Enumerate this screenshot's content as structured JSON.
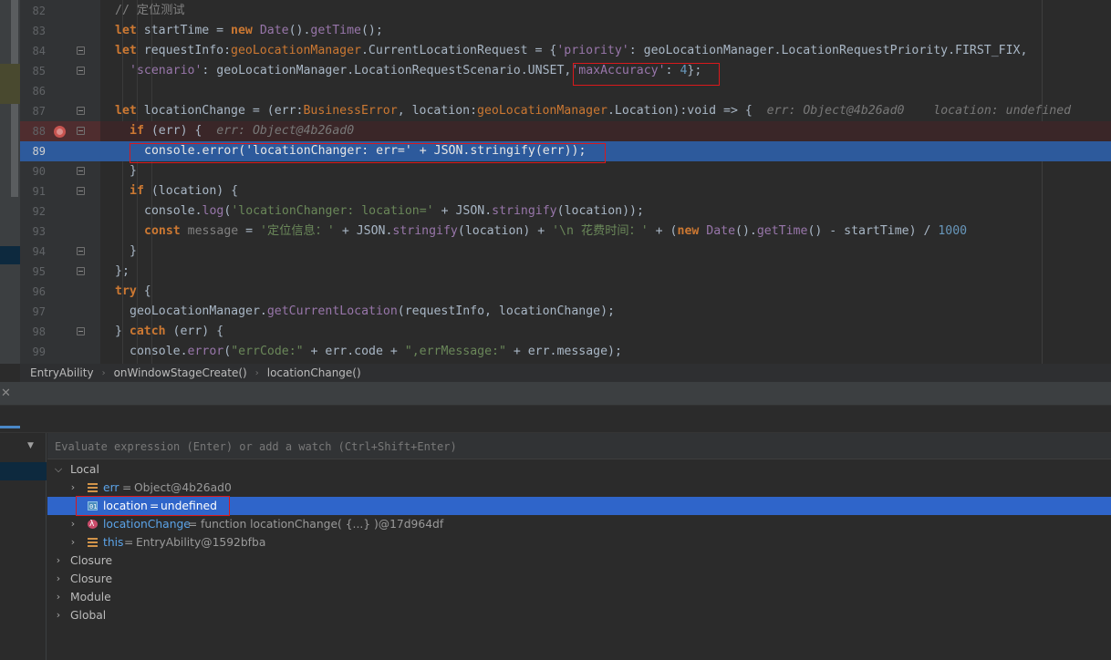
{
  "editor": {
    "lines": [
      {
        "n": "82",
        "parts": [
          {
            "t": "// 定位测试",
            "c": "cmt"
          }
        ]
      },
      {
        "n": "83",
        "parts": [
          {
            "t": "let ",
            "c": "kw"
          },
          {
            "t": "startTime = "
          },
          {
            "t": "new ",
            "c": "kw"
          },
          {
            "t": "Date",
            "c": "prop"
          },
          {
            "t": "()."
          },
          {
            "t": "getTime",
            "c": "prop"
          },
          {
            "t": "();"
          }
        ]
      },
      {
        "n": "84",
        "parts": [
          {
            "t": "let ",
            "c": "kw"
          },
          {
            "t": "requestInfo:"
          },
          {
            "t": "geoLocationManager",
            "c": "kw2"
          },
          {
            "t": ".CurrentLocationRequest = {"
          },
          {
            "t": "'priority'",
            "c": "prop"
          },
          {
            "t": ": geoLocationManager.LocationRequestPriority.FIRST_FIX,"
          }
        ]
      },
      {
        "n": "85",
        "parts": [
          {
            "t": "'scenario'",
            "c": "prop"
          },
          {
            "t": ": geoLocationManager.LocationRequestScenario.UNSET,"
          },
          {
            "t": "'maxAccuracy'",
            "c": "prop"
          },
          {
            "t": ": "
          },
          {
            "t": "4",
            "c": "num"
          },
          {
            "t": "};"
          }
        ]
      },
      {
        "n": "86",
        "parts": []
      },
      {
        "n": "87",
        "parts": [
          {
            "t": "let ",
            "c": "kw"
          },
          {
            "t": "locationChange = ("
          },
          {
            "t": "err",
            "c": ""
          },
          {
            "t": ":"
          },
          {
            "t": "BusinessError",
            "c": "kw2"
          },
          {
            "t": ", location:"
          },
          {
            "t": "geoLocationManager",
            "c": "kw2"
          },
          {
            "t": ".Location):"
          },
          {
            "t": "void",
            "c": ""
          },
          {
            "t": " => {  "
          },
          {
            "t": "err: Object@4b26ad0    location: undefined",
            "c": "hint"
          }
        ]
      },
      {
        "n": "88",
        "parts": [
          {
            "t": "if ",
            "c": "kw"
          },
          {
            "t": "(err) {  "
          },
          {
            "t": "err: Object@4b26ad0",
            "c": "hint"
          }
        ]
      },
      {
        "n": "89",
        "parts": [
          {
            "t": "console."
          },
          {
            "t": "error",
            "c": "prop"
          },
          {
            "t": "("
          },
          {
            "t": "'locationChanger: err='",
            "c": "str"
          },
          {
            "t": " + JSON."
          },
          {
            "t": "stringify",
            "c": "prop"
          },
          {
            "t": "(err));"
          }
        ]
      },
      {
        "n": "90",
        "parts": [
          {
            "t": "}"
          }
        ]
      },
      {
        "n": "91",
        "parts": [
          {
            "t": "if ",
            "c": "kw"
          },
          {
            "t": "(location) {"
          }
        ]
      },
      {
        "n": "92",
        "parts": [
          {
            "t": "console."
          },
          {
            "t": "log",
            "c": "prop"
          },
          {
            "t": "("
          },
          {
            "t": "'locationChanger: location='",
            "c": "str"
          },
          {
            "t": " + JSON."
          },
          {
            "t": "stringify",
            "c": "prop"
          },
          {
            "t": "(location));"
          }
        ]
      },
      {
        "n": "93",
        "parts": [
          {
            "t": "const ",
            "c": "kw"
          },
          {
            "t": "message",
            "c": "cmt"
          },
          {
            "t": " = "
          },
          {
            "t": "'定位信息：'",
            "c": "str"
          },
          {
            "t": " + JSON."
          },
          {
            "t": "stringify",
            "c": "prop"
          },
          {
            "t": "(location) + "
          },
          {
            "t": "'\\n 花费时间：'",
            "c": "str"
          },
          {
            "t": " + ("
          },
          {
            "t": "new ",
            "c": "kw"
          },
          {
            "t": "Date",
            "c": "prop"
          },
          {
            "t": "()."
          },
          {
            "t": "getTime",
            "c": "prop"
          },
          {
            "t": "() - startTime) / "
          },
          {
            "t": "1000",
            "c": "num"
          }
        ]
      },
      {
        "n": "94",
        "parts": [
          {
            "t": "}"
          }
        ]
      },
      {
        "n": "95",
        "parts": [
          {
            "t": "};"
          }
        ]
      },
      {
        "n": "96",
        "parts": [
          {
            "t": "try ",
            "c": "kw"
          },
          {
            "t": "{"
          }
        ]
      },
      {
        "n": "97",
        "parts": [
          {
            "t": "geoLocationManager."
          },
          {
            "t": "getCurrentLocation",
            "c": "prop"
          },
          {
            "t": "(requestInfo, locationChange);"
          }
        ]
      },
      {
        "n": "98",
        "parts": [
          {
            "t": "} "
          },
          {
            "t": "catch ",
            "c": "kw"
          },
          {
            "t": "(err) {"
          }
        ]
      },
      {
        "n": "99",
        "parts": [
          {
            "t": "console."
          },
          {
            "t": "error",
            "c": "prop"
          },
          {
            "t": "("
          },
          {
            "t": "\"errCode:\"",
            "c": "str"
          },
          {
            "t": " + err.code + "
          },
          {
            "t": "\",errMessage:\"",
            "c": "str"
          },
          {
            "t": " + err.message);"
          }
        ]
      }
    ]
  },
  "breadcrumb": {
    "items": [
      "EntryAbility",
      "onWindowStageCreate()",
      "locationChange()"
    ]
  },
  "debug": {
    "close_symbol": "✕",
    "watch_placeholder": "Evaluate expression (Enter) or add a watch (Ctrl+Shift+Enter)",
    "tree": {
      "local_label": "Local",
      "vars": [
        {
          "name": "err",
          "value": "Object@4b26ad0",
          "icon": "field-icon"
        },
        {
          "name": "location",
          "value": "undefined",
          "icon": "primitive-icon"
        },
        {
          "name": "locationChange",
          "value": "function locationChange( {...} )@17d964df",
          "icon": "lambda-icon"
        },
        {
          "name": "this",
          "value": "EntryAbility@1592bfba",
          "icon": "field-icon"
        }
      ],
      "scopes": [
        "Closure",
        "Closure",
        "Module",
        "Global"
      ]
    }
  }
}
